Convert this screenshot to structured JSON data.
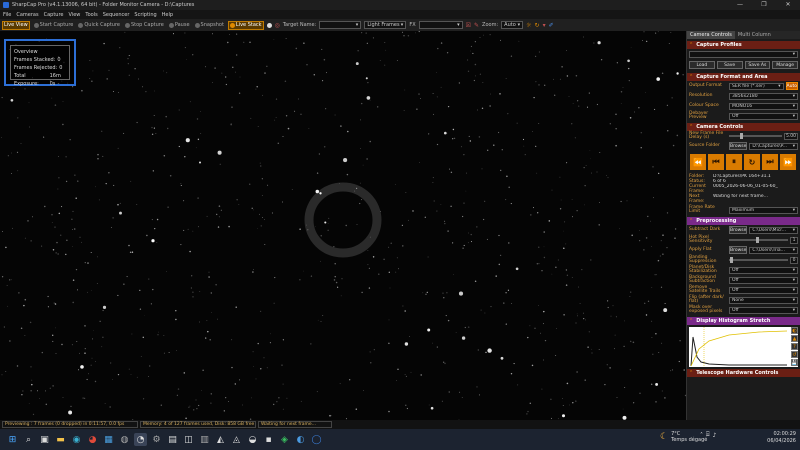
{
  "window": {
    "title": "SharpCap Pro (v4.1.13006, 64 bit) - Folder Monitor Camera - D:\\Captures",
    "controls": [
      "—",
      "❐",
      "✕"
    ]
  },
  "menu": [
    "File",
    "Cameras",
    "Capture",
    "View",
    "Tools",
    "Sequencer",
    "Scripting",
    "Help"
  ],
  "toolbar": {
    "live_view": "Live View",
    "start_capture": "Start Capture",
    "quick_capture": "Quick Capture",
    "stop_capture": "Stop Capture",
    "pause": "Pause",
    "snapshot": "Snapshot",
    "live_stack": "Live Stack",
    "target_name_label": "Target Name:",
    "target_name_value": "",
    "frame_type": "Light Frames",
    "fx_label": "FX",
    "fx_value": "",
    "zoom_label": "Zoom:",
    "zoom_value": "Auto"
  },
  "overlay": {
    "title": "Overview",
    "rows": [
      {
        "label": "Frames Stacked:",
        "value": "0"
      },
      {
        "label": "Frames Rejected:",
        "value": "0"
      },
      {
        "label": "Total Exposure:",
        "value": "16m 0s"
      }
    ]
  },
  "panel": {
    "tabs": [
      "Camera Controls",
      "Multi Column"
    ],
    "capture_profiles": {
      "title": "Capture Profiles",
      "buttons": [
        "Load",
        "Save",
        "Save As",
        "Manage"
      ]
    },
    "format": {
      "title": "Capture Format and Area",
      "rows": [
        {
          "label": "Output Format",
          "value": "SER file (*.ser)",
          "extra": "Auto"
        },
        {
          "label": "Resolution",
          "value": "3856x2180"
        },
        {
          "label": "Colour Space",
          "value": "MONO16"
        },
        {
          "label": "Debayer Preview",
          "value": "Off"
        }
      ]
    },
    "camera": {
      "title": "Camera Controls",
      "new_frame_label": "New Frame File Delay (s)",
      "new_frame_value": "5.00",
      "source_label": "Source Folder",
      "source_button": "Browse",
      "source_value": "D:\\Captures\\P...",
      "transport": [
        "⏪",
        "⏮",
        "⏸",
        "↻",
        "⏭",
        "⏩"
      ],
      "info": [
        {
          "k": "Folder:",
          "v": "D:\\Captures\\PK 164+31.1"
        },
        {
          "k": "Status:",
          "v": "6 of 6"
        },
        {
          "k": "Current Frame:",
          "v": "0005_2026-06-06_01-05-60_"
        },
        {
          "k": "Next Frame:",
          "v": "Waiting for next frame..."
        }
      ],
      "frame_rate_label": "Frame Rate Limit",
      "frame_rate_value": "Maximum"
    },
    "preprocessing": {
      "title": "Preprocessing",
      "rows": [
        {
          "label": "Subtract Dark",
          "button": "Browse",
          "value": "C:\\Users\\Micr..."
        },
        {
          "label": "Hot Pixel Sensitivity",
          "value": "1"
        },
        {
          "label": "Apply Flat",
          "button": "Browse",
          "value": "C:\\Users\\Tria..."
        },
        {
          "label": "Banding Suppression",
          "value": "0"
        },
        {
          "label": "Planet/Disk Stabilization",
          "value": "Off"
        },
        {
          "label": "Background Subtraction",
          "value": "Off"
        },
        {
          "label": "Remove Satellite Trails",
          "value": "Off"
        },
        {
          "label": "Flip (after dark/ flat)",
          "value": "None"
        },
        {
          "label": "Mask over exposed pixels",
          "value": "Off"
        }
      ]
    },
    "histogram": {
      "title": "Display Histogram Stretch",
      "side_icons": [
        "◐",
        "▲",
        "?",
        "↺",
        "💾"
      ]
    },
    "telescope": {
      "title": "Telescope Hardware Controls"
    }
  },
  "status": {
    "previewing": "Previewing : 7 frames (0 dropped) in 0:11:57, 0.0 fps",
    "memory": "Memory: 4 of 127 frames used, Disk: 858 GB free",
    "waiting": "Waiting for next frame..."
  },
  "weather": {
    "temp": "7°C",
    "desc": "Temps dégagé"
  },
  "clock": {
    "time": "02:00:29",
    "date": "06/04/2026"
  }
}
